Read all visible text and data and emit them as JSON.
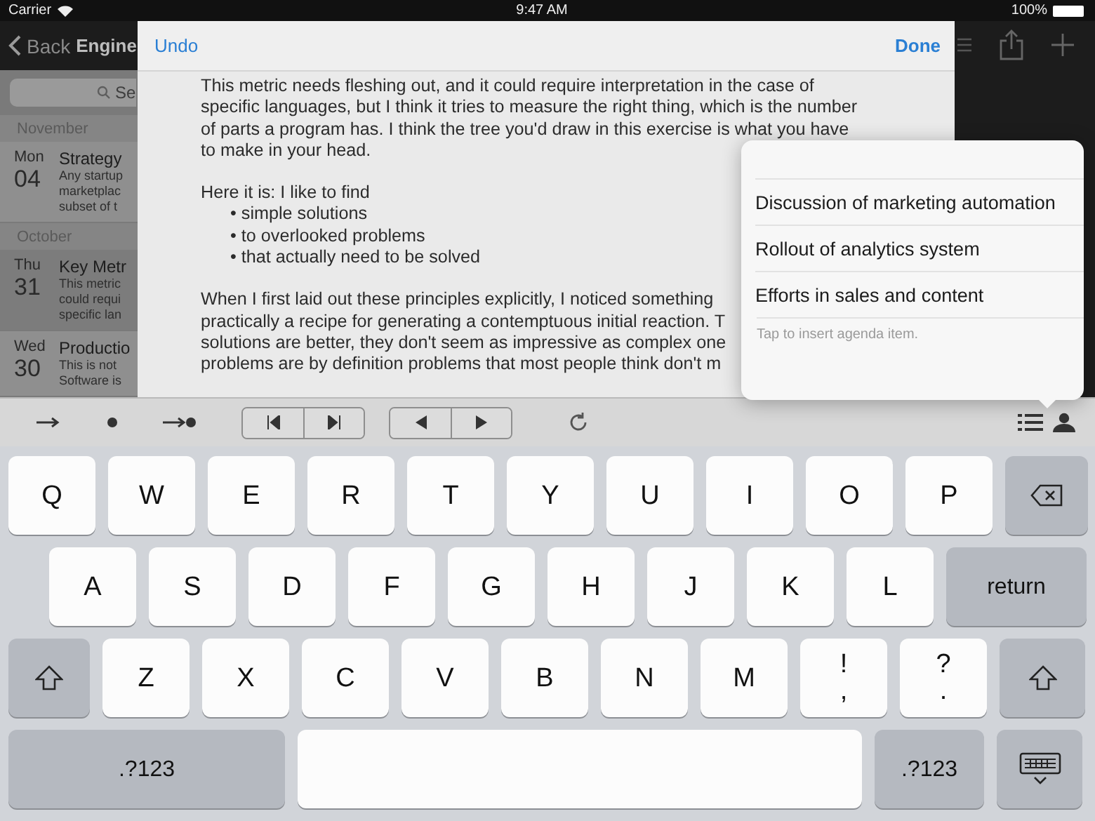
{
  "status_bar": {
    "carrier": "Carrier",
    "time": "9:47 AM",
    "battery": "100%"
  },
  "sidebar": {
    "back": "Back",
    "title": "Engine",
    "search": {
      "placeholder": "Se"
    },
    "sections": [
      {
        "header": "November",
        "items": [
          {
            "weekday": "Mon",
            "day": "04",
            "title": "Strategy",
            "preview": [
              "Any startup",
              "marketplac",
              "subset of t"
            ],
            "selected": false
          }
        ]
      },
      {
        "header": "October",
        "items": [
          {
            "weekday": "Thu",
            "day": "31",
            "title": "Key Metr",
            "preview": [
              "This metric",
              "could requi",
              "specific lan"
            ],
            "selected": true
          },
          {
            "weekday": "Wed",
            "day": "30",
            "title": "Productio",
            "preview": [
              "This is not",
              "Software is"
            ],
            "selected": false
          }
        ]
      }
    ]
  },
  "note": {
    "undo": "Undo",
    "done": "Done",
    "paragraphs": [
      {
        "lines": [
          "This metric needs fleshing out, and it could require interpretation in the case of",
          "specific languages, but I think it tries to measure the right thing, which is the number",
          "of parts a program has. I think the tree you'd draw in this exercise is what you have",
          "to make in your head."
        ]
      },
      {
        "lines": [
          "Here it is: I like to find"
        ],
        "bullets": [
          "• simple solutions",
          "• to overlooked problems",
          "• that actually need to be solved"
        ]
      },
      {
        "lines": [
          "When I first laid out these principles explicitly, I noticed something",
          "practically a recipe for generating a contemptuous initial reaction. T",
          "solutions are better, they don't seem as impressive as complex one",
          "problems are by definition problems that most people think don't m"
        ]
      }
    ]
  },
  "popover": {
    "items": [
      "Discussion of marketing automation",
      "Rollout of analytics system",
      "Efforts in sales and content"
    ],
    "hint": "Tap to insert agenda item."
  },
  "keyboard": {
    "rows": [
      {
        "keys": [
          {
            "kind": "letter",
            "label": "Q"
          },
          {
            "kind": "letter",
            "label": "W"
          },
          {
            "kind": "letter",
            "label": "E"
          },
          {
            "kind": "letter",
            "label": "R"
          },
          {
            "kind": "letter",
            "label": "T"
          },
          {
            "kind": "letter",
            "label": "Y"
          },
          {
            "kind": "letter",
            "label": "U"
          },
          {
            "kind": "letter",
            "label": "I"
          },
          {
            "kind": "letter",
            "label": "O"
          },
          {
            "kind": "letter",
            "label": "P"
          },
          {
            "kind": "backspace"
          }
        ]
      },
      {
        "keys": [
          {
            "kind": "letter",
            "label": "A"
          },
          {
            "kind": "letter",
            "label": "S"
          },
          {
            "kind": "letter",
            "label": "D"
          },
          {
            "kind": "letter",
            "label": "F"
          },
          {
            "kind": "letter",
            "label": "G"
          },
          {
            "kind": "letter",
            "label": "H"
          },
          {
            "kind": "letter",
            "label": "J"
          },
          {
            "kind": "letter",
            "label": "K"
          },
          {
            "kind": "letter",
            "label": "L"
          },
          {
            "kind": "return",
            "label": "return"
          }
        ]
      },
      {
        "keys": [
          {
            "kind": "shift"
          },
          {
            "kind": "letter",
            "label": "Z"
          },
          {
            "kind": "letter",
            "label": "X"
          },
          {
            "kind": "letter",
            "label": "C"
          },
          {
            "kind": "letter",
            "label": "V"
          },
          {
            "kind": "letter",
            "label": "B"
          },
          {
            "kind": "letter",
            "label": "N"
          },
          {
            "kind": "letter",
            "label": "M"
          },
          {
            "kind": "punct",
            "label": "!",
            "sub": ","
          },
          {
            "kind": "punct",
            "label": "?",
            "sub": "."
          },
          {
            "kind": "shift"
          }
        ]
      },
      {
        "keys": [
          {
            "kind": "symbols",
            "label": ".?123"
          },
          {
            "kind": "space"
          },
          {
            "kind": "symbols_right",
            "label": ".?123"
          },
          {
            "kind": "hide"
          }
        ]
      }
    ]
  }
}
